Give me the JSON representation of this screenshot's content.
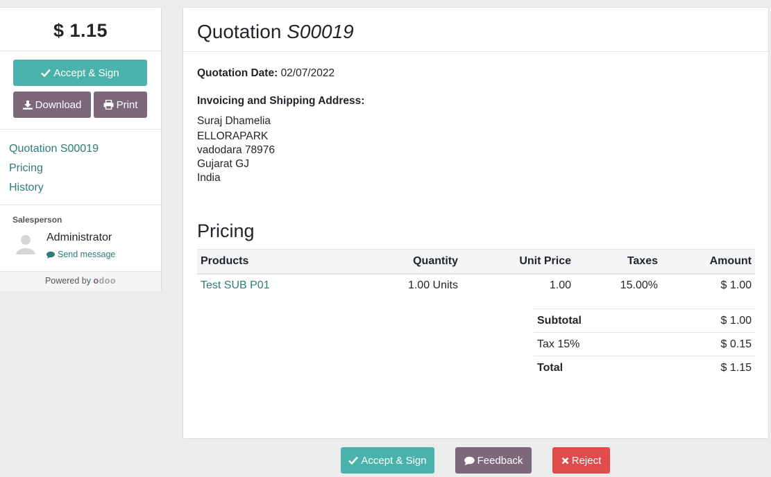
{
  "sidebar": {
    "total": "$ 1.15",
    "accept_label": "Accept & Sign",
    "download_label": "Download",
    "print_label": "Print",
    "nav": [
      "Quotation S00019",
      "Pricing",
      "History"
    ],
    "salesperson_title": "Salesperson",
    "salesperson_name": "Administrator",
    "send_message": "Send message",
    "powered_by": "Powered by",
    "brand_o1": "o",
    "brand_rest": "doo"
  },
  "main": {
    "title_prefix": "Quotation",
    "title_number": "S00019",
    "date_label": "Quotation Date:",
    "date_value": "02/07/2022",
    "address_title": "Invoicing and Shipping Address:",
    "address_lines": [
      "Suraj Dhamelia",
      "ELLORAPARK",
      "vadodara 78976",
      "Gujarat GJ",
      "India"
    ],
    "pricing_heading": "Pricing",
    "columns": [
      "Products",
      "Quantity",
      "Unit Price",
      "Taxes",
      "Amount"
    ],
    "rows": [
      {
        "product": "Test SUB P01",
        "quantity": "1.00 Units",
        "unit_price": "1.00",
        "taxes": "15.00%",
        "amount": "$ 1.00"
      }
    ],
    "totals": [
      {
        "label": "Subtotal",
        "value": "$ 1.00"
      },
      {
        "label": "Tax 15%",
        "value": "$ 0.15"
      },
      {
        "label": "Total",
        "value": "$ 1.15"
      }
    ]
  },
  "footer_actions": {
    "accept_label": "Accept & Sign",
    "feedback_label": "Feedback",
    "reject_label": "Reject"
  },
  "colors": {
    "primary": "#49b2ab",
    "secondary": "#7c6879",
    "danger": "#e04b4b",
    "link": "#2f7b78"
  }
}
